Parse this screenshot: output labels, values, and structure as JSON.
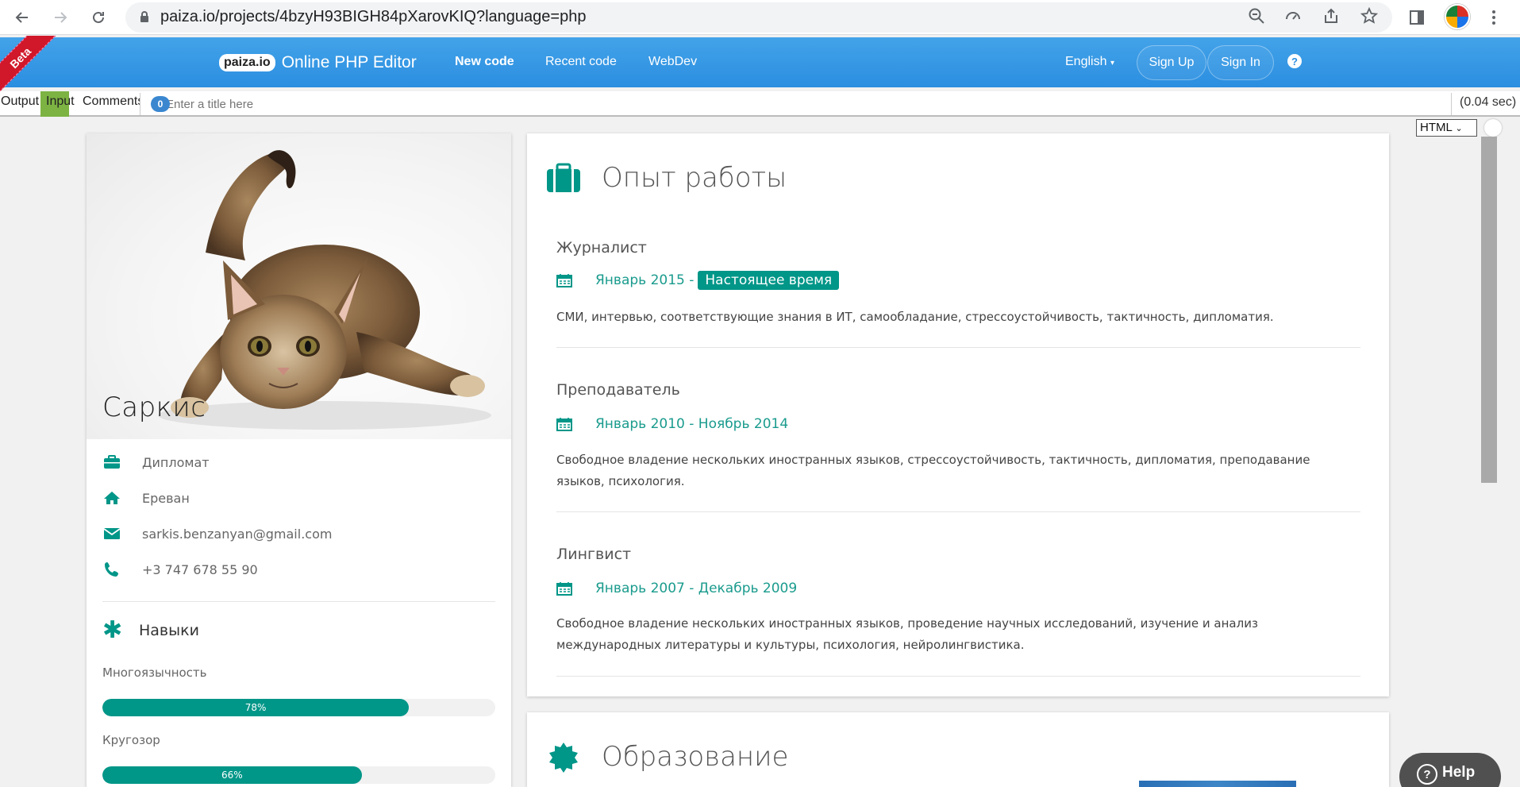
{
  "browser": {
    "url": "paiza.io/projects/4bzyH93BIGH84pXarovKIQ?language=php"
  },
  "header": {
    "beta_label": "Beta",
    "logo_badge": "paiza.io",
    "title": "Online PHP Editor",
    "nav": [
      "New code",
      "Recent code",
      "WebDev"
    ],
    "language": "English",
    "sign_up": "Sign Up",
    "sign_in": "Sign In",
    "help_icon": "?"
  },
  "tabs": {
    "output": "Output",
    "input": "Input",
    "comments": "Comments",
    "comments_count": "0",
    "title_placeholder": "Enter a title here",
    "elapsed": "(0.04 sec)",
    "view_mode": "HTML"
  },
  "profile": {
    "name": "Саркис",
    "info": [
      {
        "icon": "briefcase-icon",
        "text": "Дипломат"
      },
      {
        "icon": "home-icon",
        "text": "Ереван"
      },
      {
        "icon": "envelope-icon",
        "text": "sarkis.benzanyan@gmail.com"
      },
      {
        "icon": "phone-icon",
        "text": "+3 747 678 55 90"
      }
    ],
    "skills_title": "Навыки",
    "skills": [
      {
        "label": "Многоязычность",
        "percent": 78,
        "percent_text": "78%"
      },
      {
        "label": "Кругозор",
        "percent": 66,
        "percent_text": "66%"
      }
    ]
  },
  "experience": {
    "title": "Опыт работы",
    "jobs": [
      {
        "title": "Журналист",
        "date": "Январь 2015 -",
        "tag": "Настоящее время",
        "desc": "СМИ, интервью, соответствующие знания в ИТ, самообладание, стрессоустойчивость, тактичность, дипломатия."
      },
      {
        "title": "Преподаватель",
        "date": "Январь 2010 - Ноябрь 2014",
        "tag": "",
        "desc": "Свободное владение нескольких иностранных языков, стрессоустойчивость, тактичность, дипломатия, преподавание языков, психология."
      },
      {
        "title": "Лингвист",
        "date": "Январь 2007 - Декабрь 2009",
        "tag": "",
        "desc": "Свободное владение нескольких иностранных языков, проведение научных исследований, изучение и анализ международных литературы и культуры, психология, нейролингвистика."
      }
    ]
  },
  "education": {
    "title": "Образование"
  },
  "help_widget": {
    "label": "Help"
  },
  "colors": {
    "accent": "#009688",
    "header_blue": "#2b8ee0",
    "beta_red": "#d0182a"
  }
}
